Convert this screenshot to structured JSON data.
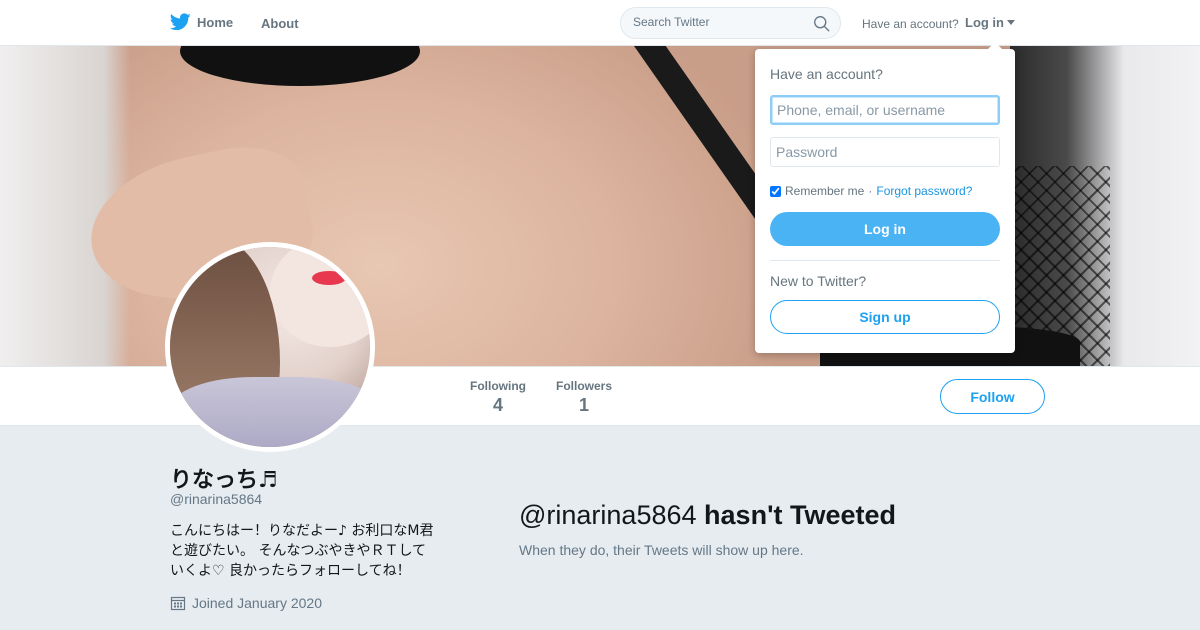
{
  "nav": {
    "home_label": "Home",
    "about_label": "About",
    "search_placeholder": "Search Twitter",
    "have_account": "Have an account?",
    "login_label": "Log in"
  },
  "login_dropdown": {
    "title": "Have an account?",
    "username_placeholder": "Phone, email, or username",
    "password_placeholder": "Password",
    "remember_label": "Remember me",
    "separator": "·",
    "forgot_label": "Forgot password?",
    "login_button": "Log in",
    "new_label": "New to Twitter?",
    "signup_button": "Sign up",
    "remember_checked": true
  },
  "profile": {
    "name": "りなっち♬",
    "handle": "@rinarina5864",
    "bio": "こんにちはー！りなだよー♪ お利口なM君と遊びたい。 そんなつぶやきやＲＴしていくよ♡ 良かったらフォローしてね！",
    "joined": "Joined January 2020",
    "stats": [
      {
        "label": "Following",
        "value": "4"
      },
      {
        "label": "Followers",
        "value": "1"
      }
    ],
    "follow_button": "Follow"
  },
  "timeline": {
    "handle": "@rinarina5864",
    "message": "hasn't Tweeted",
    "subtext": "When they do, their Tweets will show up here."
  },
  "colors": {
    "brand": "#1da1f2",
    "login_button": "#4ab3f4",
    "background": "#e6ecf0"
  },
  "icons": [
    "twitter-bird-icon",
    "search-icon",
    "caret-down-icon",
    "calendar-icon"
  ]
}
